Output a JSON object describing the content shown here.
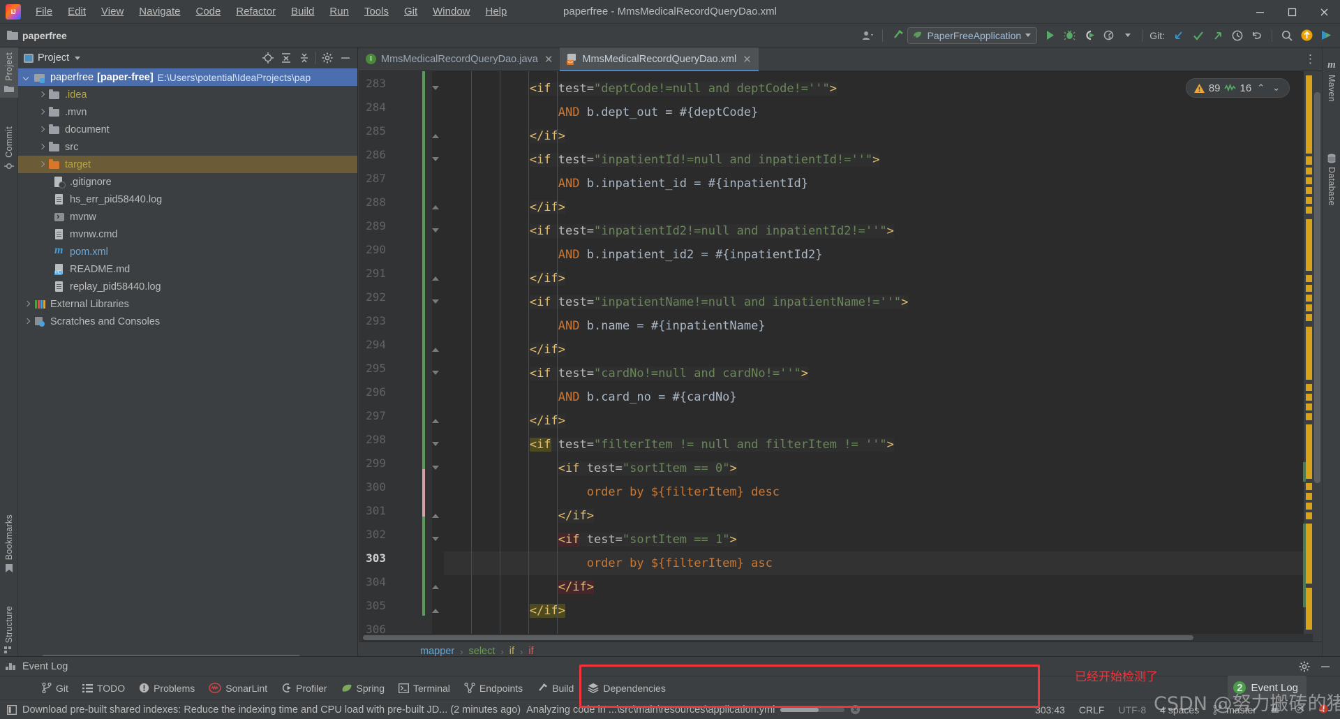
{
  "window": {
    "title": "paperfree - MmsMedicalRecordQueryDao.xml",
    "minimize_label": "—",
    "maximize_label": "❐",
    "close_label": "✕"
  },
  "menu": {
    "items": [
      {
        "label": "File"
      },
      {
        "label": "Edit"
      },
      {
        "label": "View"
      },
      {
        "label": "Navigate"
      },
      {
        "label": "Code"
      },
      {
        "label": "Refactor"
      },
      {
        "label": "Build"
      },
      {
        "label": "Run"
      },
      {
        "label": "Tools"
      },
      {
        "label": "Git"
      },
      {
        "label": "Window"
      },
      {
        "label": "Help"
      }
    ]
  },
  "toolbar": {
    "project_chip": "paperfree",
    "run_config": "PaperFreeApplication",
    "git_label": "Git:",
    "icons": [
      {
        "name": "profile-icon"
      },
      {
        "name": "build-hammer-icon"
      },
      {
        "name": "run-icon"
      },
      {
        "name": "debug-icon"
      },
      {
        "name": "run-coverage-icon"
      },
      {
        "name": "profiler-run-icon"
      },
      {
        "name": "update-project-icon"
      },
      {
        "name": "commit-icon"
      },
      {
        "name": "push-icon"
      },
      {
        "name": "history-icon"
      },
      {
        "name": "rollback-icon"
      },
      {
        "name": "search-everywhere-icon"
      },
      {
        "name": "notification-update-icon"
      },
      {
        "name": "ide-feature-icon"
      }
    ]
  },
  "left_strip": {
    "tabs": [
      {
        "label": "Project",
        "icon": "folder-icon",
        "active": true
      },
      {
        "label": "Commit",
        "icon": "commit-icon",
        "active": false
      },
      {
        "label": "Bookmarks",
        "icon": "bookmark-icon",
        "active": false
      },
      {
        "label": "Structure",
        "icon": "structure-icon",
        "active": false
      }
    ]
  },
  "right_strip": {
    "tabs": [
      {
        "label": "Maven",
        "icon": "maven-icon"
      },
      {
        "label": "Database",
        "icon": "database-icon"
      }
    ]
  },
  "project_panel": {
    "title": "Project",
    "actions": [
      "locate-icon",
      "expand-all-icon",
      "collapse-all-icon",
      "settings-gear-icon",
      "hide-icon"
    ],
    "tree": [
      {
        "label": "paperfree",
        "bold_suffix": "[paper-free]",
        "path": "E:\\Users\\potential\\IdeaProjects\\pap",
        "icon": "folder-module-icon",
        "arrow": "down",
        "depth": 0,
        "state": "selected"
      },
      {
        "label": ".idea",
        "icon": "folder-icon",
        "arrow": "right",
        "depth": 1,
        "color": "yellow"
      },
      {
        "label": ".mvn",
        "icon": "folder-icon",
        "arrow": "right",
        "depth": 1
      },
      {
        "label": "document",
        "icon": "folder-icon",
        "arrow": "right",
        "depth": 1
      },
      {
        "label": "src",
        "icon": "folder-icon",
        "arrow": "right",
        "depth": 1
      },
      {
        "label": "target",
        "icon": "folder-orange-icon",
        "arrow": "right",
        "depth": 1,
        "color": "yellow",
        "state": "highlight"
      },
      {
        "label": ".gitignore",
        "icon": "gitignore-file-icon",
        "depth": 2
      },
      {
        "label": "hs_err_pid58440.log",
        "icon": "text-file-icon",
        "depth": 2
      },
      {
        "label": "mvnw",
        "icon": "shell-script-icon",
        "depth": 2
      },
      {
        "label": "mvnw.cmd",
        "icon": "text-file-icon",
        "depth": 2
      },
      {
        "label": "pom.xml",
        "icon": "maven-pom-icon",
        "depth": 2,
        "color": "blue"
      },
      {
        "label": "README.md",
        "icon": "markdown-file-icon",
        "depth": 2
      },
      {
        "label": "replay_pid58440.log",
        "icon": "text-file-icon",
        "depth": 2
      },
      {
        "label": "External Libraries",
        "icon": "libraries-icon",
        "arrow": "right",
        "depth": 0
      },
      {
        "label": "Scratches and Consoles",
        "icon": "scratches-icon",
        "arrow": "right",
        "depth": 0
      }
    ]
  },
  "editor": {
    "tabs": [
      {
        "label": "MmsMedicalRecordQueryDao.java",
        "icon": "java-file-icon",
        "active": false,
        "close": "✕"
      },
      {
        "label": "MmsMedicalRecordQueryDao.xml",
        "icon": "xml-file-icon",
        "active": true,
        "close": "✕"
      }
    ],
    "more_tabs": "⋮",
    "inspection": {
      "warning_icon": "warning-triangle-icon",
      "warning_count": "89",
      "check_icon": "inspection-scribble-icon",
      "check_count": "16",
      "prev": "⌃",
      "next": "⌄"
    },
    "first_line": 283,
    "current_line": 303,
    "lines": [
      {
        "n": 283,
        "indent": 3,
        "tokens": [
          {
            "t": "<if",
            "c": "tag",
            "bg": "block"
          },
          {
            "t": " ",
            "c": "txt",
            "bg": "block"
          },
          {
            "t": "test=",
            "c": "attr",
            "bg": "block"
          },
          {
            "t": "\"deptCode!=null and deptCode!=''\"",
            "c": "val",
            "bg": "block"
          },
          {
            "t": ">",
            "c": "tag",
            "bg": "block"
          }
        ]
      },
      {
        "n": 284,
        "indent": 4,
        "tokens": [
          {
            "t": "AND",
            "c": "kw"
          },
          {
            "t": " b.dept_out = #{deptCode}",
            "c": "txt"
          }
        ]
      },
      {
        "n": 285,
        "indent": 3,
        "tokens": [
          {
            "t": "</if>",
            "c": "tag",
            "bg": "block"
          }
        ]
      },
      {
        "n": 286,
        "indent": 3,
        "tokens": [
          {
            "t": "<if",
            "c": "tag",
            "bg": "block"
          },
          {
            "t": " ",
            "c": "txt",
            "bg": "block"
          },
          {
            "t": "test=",
            "c": "attr",
            "bg": "block"
          },
          {
            "t": "\"inpatientId!=null and inpatientId!=''\"",
            "c": "val",
            "bg": "block"
          },
          {
            "t": ">",
            "c": "tag",
            "bg": "block"
          }
        ]
      },
      {
        "n": 287,
        "indent": 4,
        "tokens": [
          {
            "t": "AND",
            "c": "kw"
          },
          {
            "t": " b.inpatient_id = #{inpatientId}",
            "c": "txt"
          }
        ]
      },
      {
        "n": 288,
        "indent": 3,
        "tokens": [
          {
            "t": "</if>",
            "c": "tag",
            "bg": "block"
          }
        ]
      },
      {
        "n": 289,
        "indent": 3,
        "tokens": [
          {
            "t": "<if",
            "c": "tag",
            "bg": "block"
          },
          {
            "t": " ",
            "c": "txt",
            "bg": "block"
          },
          {
            "t": "test=",
            "c": "attr",
            "bg": "block"
          },
          {
            "t": "\"inpatientId2!=null and inpatientId2!=''\"",
            "c": "val",
            "bg": "block"
          },
          {
            "t": ">",
            "c": "tag",
            "bg": "block"
          }
        ]
      },
      {
        "n": 290,
        "indent": 4,
        "tokens": [
          {
            "t": "AND",
            "c": "kw"
          },
          {
            "t": " b.inpatient_id2 = #{inpatientId2}",
            "c": "txt"
          }
        ]
      },
      {
        "n": 291,
        "indent": 3,
        "tokens": [
          {
            "t": "</if>",
            "c": "tag",
            "bg": "block"
          }
        ]
      },
      {
        "n": 292,
        "indent": 3,
        "tokens": [
          {
            "t": "<if",
            "c": "tag",
            "bg": "block"
          },
          {
            "t": " ",
            "c": "txt",
            "bg": "block"
          },
          {
            "t": "test=",
            "c": "attr",
            "bg": "block"
          },
          {
            "t": "\"inpatientName!=null and inpatientName!=''\"",
            "c": "val",
            "bg": "block"
          },
          {
            "t": ">",
            "c": "tag",
            "bg": "block"
          }
        ]
      },
      {
        "n": 293,
        "indent": 4,
        "tokens": [
          {
            "t": "AND",
            "c": "kw"
          },
          {
            "t": " b.name = #{inpatientName}",
            "c": "txt"
          }
        ]
      },
      {
        "n": 294,
        "indent": 3,
        "tokens": [
          {
            "t": "</if>",
            "c": "tag",
            "bg": "block"
          }
        ]
      },
      {
        "n": 295,
        "indent": 3,
        "tokens": [
          {
            "t": "<if",
            "c": "tag",
            "bg": "block"
          },
          {
            "t": " ",
            "c": "txt",
            "bg": "block"
          },
          {
            "t": "test=",
            "c": "attr",
            "bg": "block"
          },
          {
            "t": "\"cardNo!=null and cardNo!=''\"",
            "c": "val",
            "bg": "block"
          },
          {
            "t": ">",
            "c": "tag",
            "bg": "block"
          }
        ]
      },
      {
        "n": 296,
        "indent": 4,
        "tokens": [
          {
            "t": "AND",
            "c": "kw"
          },
          {
            "t": " b.card_no = #{cardNo}",
            "c": "txt"
          }
        ]
      },
      {
        "n": 297,
        "indent": 3,
        "tokens": [
          {
            "t": "</if>",
            "c": "tag",
            "bg": "block"
          }
        ]
      },
      {
        "n": 298,
        "indent": 3,
        "tokens": [
          {
            "t": "<if",
            "c": "tag",
            "bg": "olive"
          },
          {
            "t": " ",
            "c": "txt",
            "bg": "block"
          },
          {
            "t": "test=",
            "c": "attr",
            "bg": "block"
          },
          {
            "t": "\"filterItem != null and filterItem != ''\"",
            "c": "val",
            "bg": "block"
          },
          {
            "t": ">",
            "c": "tag",
            "bg": "block"
          }
        ]
      },
      {
        "n": 299,
        "indent": 4,
        "tokens": [
          {
            "t": "<if",
            "c": "tag",
            "bg": "block"
          },
          {
            "t": " ",
            "c": "txt",
            "bg": "block"
          },
          {
            "t": "test=",
            "c": "attr",
            "bg": "block"
          },
          {
            "t": "\"sortItem == 0\"",
            "c": "val",
            "bg": "block"
          },
          {
            "t": ">",
            "c": "tag",
            "bg": "block"
          }
        ]
      },
      {
        "n": 300,
        "indent": 5,
        "tokens": [
          {
            "t": "order by ${filterItem} desc",
            "c": "kw2"
          }
        ]
      },
      {
        "n": 301,
        "indent": 4,
        "tokens": [
          {
            "t": "</if>",
            "c": "tag",
            "bg": "block"
          }
        ]
      },
      {
        "n": 302,
        "indent": 4,
        "tokens": [
          {
            "t": "<if",
            "c": "tag",
            "bg": "maroon"
          },
          {
            "t": " ",
            "c": "txt",
            "bg": "block"
          },
          {
            "t": "test=",
            "c": "attr",
            "bg": "block"
          },
          {
            "t": "\"sortItem == 1\"",
            "c": "val",
            "bg": "block"
          },
          {
            "t": ">",
            "c": "tag",
            "bg": "block"
          }
        ]
      },
      {
        "n": 303,
        "indent": 5,
        "tokens": [
          {
            "t": "order by ${filterItem} asc",
            "c": "kw2"
          }
        ]
      },
      {
        "n": 304,
        "indent": 4,
        "tokens": [
          {
            "t": "</if>",
            "c": "tag",
            "bg": "maroon"
          }
        ]
      },
      {
        "n": 305,
        "indent": 3,
        "tokens": [
          {
            "t": "</if>",
            "c": "tag",
            "bg": "olive"
          }
        ]
      },
      {
        "n": 306,
        "indent": 0,
        "tokens": []
      }
    ]
  },
  "breadcrumbs": {
    "items": [
      {
        "label": "mapper",
        "color": "mapper"
      },
      {
        "label": "select",
        "color": "select"
      },
      {
        "label": "if",
        "color": "if1"
      },
      {
        "label": "if",
        "color": "if2"
      }
    ],
    "separator": "›"
  },
  "event_log_bar": {
    "label": "Event Log",
    "settings_icon": "gear-icon",
    "hide_icon": "minimize-icon"
  },
  "status_tools": {
    "items": [
      {
        "label": "Git",
        "icon": "git-branch-icon"
      },
      {
        "label": "TODO",
        "icon": "todo-list-icon"
      },
      {
        "label": "Problems",
        "icon": "problems-icon"
      },
      {
        "label": "SonarLint",
        "icon": "sonarlint-icon"
      },
      {
        "label": "Profiler",
        "icon": "profiler-icon"
      },
      {
        "label": "Spring",
        "icon": "spring-leaf-icon"
      },
      {
        "label": "Terminal",
        "icon": "terminal-icon"
      },
      {
        "label": "Endpoints",
        "icon": "endpoints-icon"
      },
      {
        "label": "Build",
        "icon": "build-hammer-icon"
      },
      {
        "label": "Dependencies",
        "icon": "dependencies-stack-icon"
      }
    ]
  },
  "statusbar": {
    "message": "Download pre-built shared indexes: Reduce the indexing time and CPU load with pre-built JD... (2 minutes ago)",
    "progress_text": "Analyzing code in ...\\src\\main\\resources\\application.yml",
    "progress_cancel_icon": "cancel-icon",
    "caret_position": "303:43",
    "line_separator": "CRLF",
    "encoding": "UTF-8",
    "indent": "4 spaces",
    "branch": "master",
    "lock_icon": "read-only-icon",
    "inspection_icon": "inspections-widget-icon",
    "memory_icon": "memory-indicator-icon"
  },
  "event_log_popup": {
    "badge": "2",
    "label": "Event Log"
  },
  "annotations": {
    "chinese_note": "已经开始检测了",
    "watermark": "CSDN @努力搬砖的猪头",
    "highlight_color": "#f0353c"
  }
}
